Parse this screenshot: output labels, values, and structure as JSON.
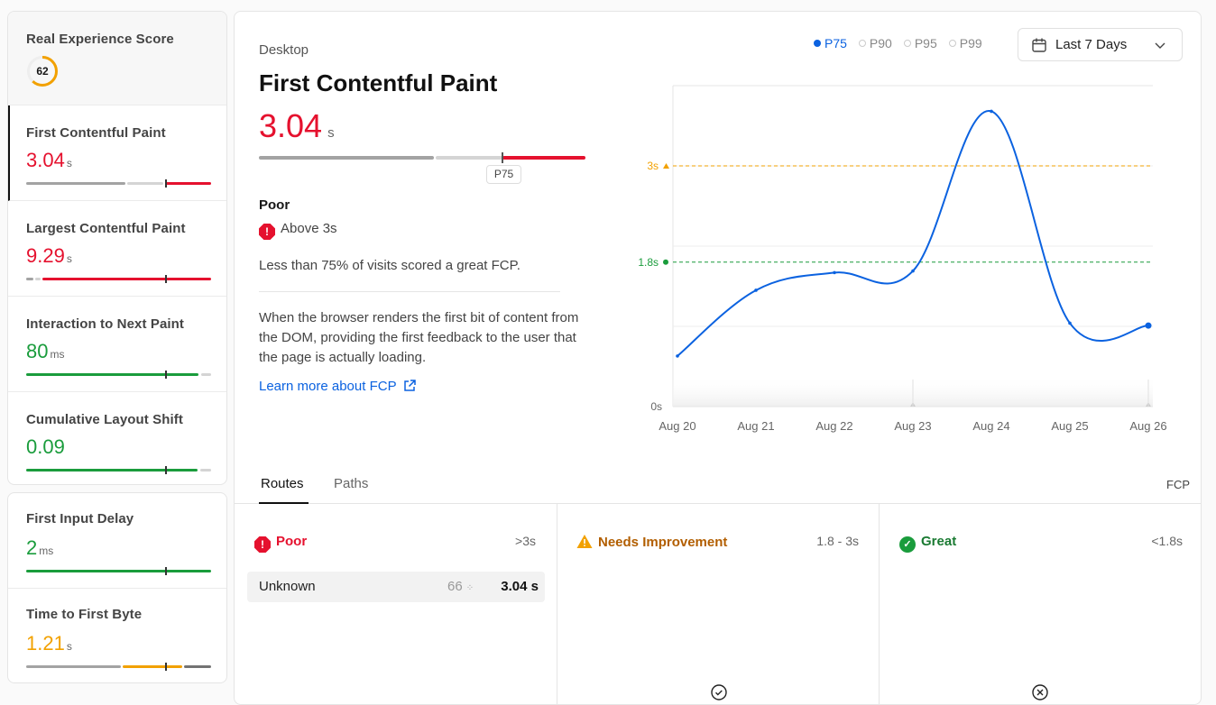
{
  "sidebar": {
    "res": {
      "label": "Real Experience Score",
      "score": "62"
    },
    "metrics": [
      {
        "name": "First Contentful Paint",
        "value": "3.04",
        "unit": "s",
        "status": "poor",
        "p75": 0.75
      },
      {
        "name": "Largest Contentful Paint",
        "value": "9.29",
        "unit": "s",
        "status": "poor",
        "p75": 0.75
      },
      {
        "name": "Interaction to Next Paint",
        "value": "80",
        "unit": "ms",
        "status": "good",
        "p75": 0.75
      },
      {
        "name": "Cumulative Layout Shift",
        "value": "0.09",
        "unit": "",
        "status": "good",
        "p75": 0.75
      }
    ],
    "metrics2": [
      {
        "name": "First Input Delay",
        "value": "2",
        "unit": "ms",
        "status": "good",
        "p75": 0.75
      },
      {
        "name": "Time to First Byte",
        "value": "1.21",
        "unit": "s",
        "status": "needs",
        "p75": 0.75
      }
    ]
  },
  "detail": {
    "device": "Desktop",
    "title": "First Contentful Paint",
    "value": "3.04",
    "unit": "s",
    "marker_label": "P75",
    "rating": "Poor",
    "rating_note": "Above 3s",
    "summary": "Less than 75% of visits scored a great FCP.",
    "description": "When the browser renders the first bit of content from the DOM, providing the first feedback to the user that the page is actually loading.",
    "learn_more": "Learn more about FCP"
  },
  "percentiles": [
    "P75",
    "P90",
    "P95",
    "P99"
  ],
  "date_range": "Last 7 Days",
  "chart_data": {
    "type": "line",
    "x": [
      "Aug 20",
      "Aug 21",
      "Aug 22",
      "Aug 23",
      "Aug 24",
      "Aug 25",
      "Aug 26"
    ],
    "series": [
      {
        "name": "P75",
        "values": [
          0.63,
          1.45,
          1.67,
          1.69,
          3.68,
          1.04,
          1.01
        ]
      }
    ],
    "thresholds": [
      {
        "label": "3s",
        "value": 3.0,
        "color": "#f2a100"
      },
      {
        "label": "1.8s",
        "value": 1.8,
        "color": "#1a9c3c"
      }
    ],
    "y_tick_label": "0s",
    "grid": true
  },
  "tabs": [
    "Routes",
    "Paths"
  ],
  "metric_short": "FCP",
  "columns": [
    {
      "label": "Poor",
      "range": ">3s",
      "rows": [
        {
          "route": "Unknown",
          "visits": "66",
          "value": "3.04 s"
        }
      ]
    },
    {
      "label": "Needs Improvement",
      "range": "1.8 - 3s",
      "rows": []
    },
    {
      "label": "Great",
      "range": "<1.8s",
      "rows": []
    }
  ],
  "colors": {
    "poor": "#e5112e",
    "needs": "#f2a100",
    "good": "#1a9c3c",
    "accent": "#0b62e0"
  }
}
